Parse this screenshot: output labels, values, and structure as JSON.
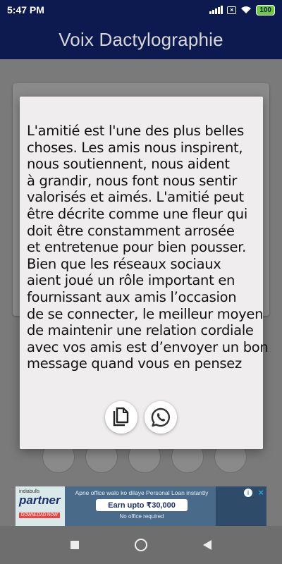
{
  "status_bar": {
    "time": "5:47 PM",
    "battery": "100"
  },
  "app_bar": {
    "title": "Voix Dactylographie"
  },
  "dialog": {
    "message_lines": [
      "L'amitié est l'une des plus belles",
      "choses. Les amis nous inspirent,",
      "nous soutiennent, nous aident",
      "à grandir, nous font nous sentir",
      "valorisés et aimés. L'amitié peut",
      "être décrite comme une fleur qui",
      "doit être constamment arrosée",
      "et entretenue pour bien pousser.",
      "Bien que les réseaux sociaux",
      "aient joué un rôle important en",
      "fournissant aux amis l’occasion",
      "de se connecter, le meilleur moyen",
      "de maintenir une relation cordiale",
      "avec vos amis est d’envoyer un bon",
      "message quand vous en pensez"
    ],
    "buttons": [
      {
        "icon": "copy-icon"
      },
      {
        "icon": "whatsapp-icon"
      }
    ]
  },
  "ad": {
    "brand_small": "indiabulls",
    "brand": "partner",
    "brand_cta": "DOWNLOAD NOW",
    "line1": "Apne office walo ko dilaye Personal Loan instantly",
    "line2": "Earn upto ₹30,000",
    "line3": "No office required"
  },
  "colors": {
    "header": "#0c1a4f",
    "dialog_bg": "#efedee",
    "scrim": "#7a7a7a",
    "whatsapp": "#333333"
  }
}
